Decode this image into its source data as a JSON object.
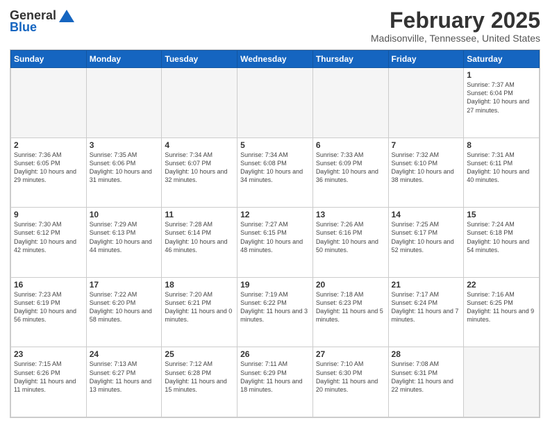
{
  "header": {
    "logo_general": "General",
    "logo_blue": "Blue",
    "month_title": "February 2025",
    "location": "Madisonville, Tennessee, United States"
  },
  "days_of_week": [
    "Sunday",
    "Monday",
    "Tuesday",
    "Wednesday",
    "Thursday",
    "Friday",
    "Saturday"
  ],
  "weeks": [
    [
      {
        "day": "",
        "info": ""
      },
      {
        "day": "",
        "info": ""
      },
      {
        "day": "",
        "info": ""
      },
      {
        "day": "",
        "info": ""
      },
      {
        "day": "",
        "info": ""
      },
      {
        "day": "",
        "info": ""
      },
      {
        "day": "1",
        "info": "Sunrise: 7:37 AM\nSunset: 6:04 PM\nDaylight: 10 hours and 27 minutes."
      }
    ],
    [
      {
        "day": "2",
        "info": "Sunrise: 7:36 AM\nSunset: 6:05 PM\nDaylight: 10 hours and 29 minutes."
      },
      {
        "day": "3",
        "info": "Sunrise: 7:35 AM\nSunset: 6:06 PM\nDaylight: 10 hours and 31 minutes."
      },
      {
        "day": "4",
        "info": "Sunrise: 7:34 AM\nSunset: 6:07 PM\nDaylight: 10 hours and 32 minutes."
      },
      {
        "day": "5",
        "info": "Sunrise: 7:34 AM\nSunset: 6:08 PM\nDaylight: 10 hours and 34 minutes."
      },
      {
        "day": "6",
        "info": "Sunrise: 7:33 AM\nSunset: 6:09 PM\nDaylight: 10 hours and 36 minutes."
      },
      {
        "day": "7",
        "info": "Sunrise: 7:32 AM\nSunset: 6:10 PM\nDaylight: 10 hours and 38 minutes."
      },
      {
        "day": "8",
        "info": "Sunrise: 7:31 AM\nSunset: 6:11 PM\nDaylight: 10 hours and 40 minutes."
      }
    ],
    [
      {
        "day": "9",
        "info": "Sunrise: 7:30 AM\nSunset: 6:12 PM\nDaylight: 10 hours and 42 minutes."
      },
      {
        "day": "10",
        "info": "Sunrise: 7:29 AM\nSunset: 6:13 PM\nDaylight: 10 hours and 44 minutes."
      },
      {
        "day": "11",
        "info": "Sunrise: 7:28 AM\nSunset: 6:14 PM\nDaylight: 10 hours and 46 minutes."
      },
      {
        "day": "12",
        "info": "Sunrise: 7:27 AM\nSunset: 6:15 PM\nDaylight: 10 hours and 48 minutes."
      },
      {
        "day": "13",
        "info": "Sunrise: 7:26 AM\nSunset: 6:16 PM\nDaylight: 10 hours and 50 minutes."
      },
      {
        "day": "14",
        "info": "Sunrise: 7:25 AM\nSunset: 6:17 PM\nDaylight: 10 hours and 52 minutes."
      },
      {
        "day": "15",
        "info": "Sunrise: 7:24 AM\nSunset: 6:18 PM\nDaylight: 10 hours and 54 minutes."
      }
    ],
    [
      {
        "day": "16",
        "info": "Sunrise: 7:23 AM\nSunset: 6:19 PM\nDaylight: 10 hours and 56 minutes."
      },
      {
        "day": "17",
        "info": "Sunrise: 7:22 AM\nSunset: 6:20 PM\nDaylight: 10 hours and 58 minutes."
      },
      {
        "day": "18",
        "info": "Sunrise: 7:20 AM\nSunset: 6:21 PM\nDaylight: 11 hours and 0 minutes."
      },
      {
        "day": "19",
        "info": "Sunrise: 7:19 AM\nSunset: 6:22 PM\nDaylight: 11 hours and 3 minutes."
      },
      {
        "day": "20",
        "info": "Sunrise: 7:18 AM\nSunset: 6:23 PM\nDaylight: 11 hours and 5 minutes."
      },
      {
        "day": "21",
        "info": "Sunrise: 7:17 AM\nSunset: 6:24 PM\nDaylight: 11 hours and 7 minutes."
      },
      {
        "day": "22",
        "info": "Sunrise: 7:16 AM\nSunset: 6:25 PM\nDaylight: 11 hours and 9 minutes."
      }
    ],
    [
      {
        "day": "23",
        "info": "Sunrise: 7:15 AM\nSunset: 6:26 PM\nDaylight: 11 hours and 11 minutes."
      },
      {
        "day": "24",
        "info": "Sunrise: 7:13 AM\nSunset: 6:27 PM\nDaylight: 11 hours and 13 minutes."
      },
      {
        "day": "25",
        "info": "Sunrise: 7:12 AM\nSunset: 6:28 PM\nDaylight: 11 hours and 15 minutes."
      },
      {
        "day": "26",
        "info": "Sunrise: 7:11 AM\nSunset: 6:29 PM\nDaylight: 11 hours and 18 minutes."
      },
      {
        "day": "27",
        "info": "Sunrise: 7:10 AM\nSunset: 6:30 PM\nDaylight: 11 hours and 20 minutes."
      },
      {
        "day": "28",
        "info": "Sunrise: 7:08 AM\nSunset: 6:31 PM\nDaylight: 11 hours and 22 minutes."
      },
      {
        "day": "",
        "info": ""
      }
    ]
  ]
}
